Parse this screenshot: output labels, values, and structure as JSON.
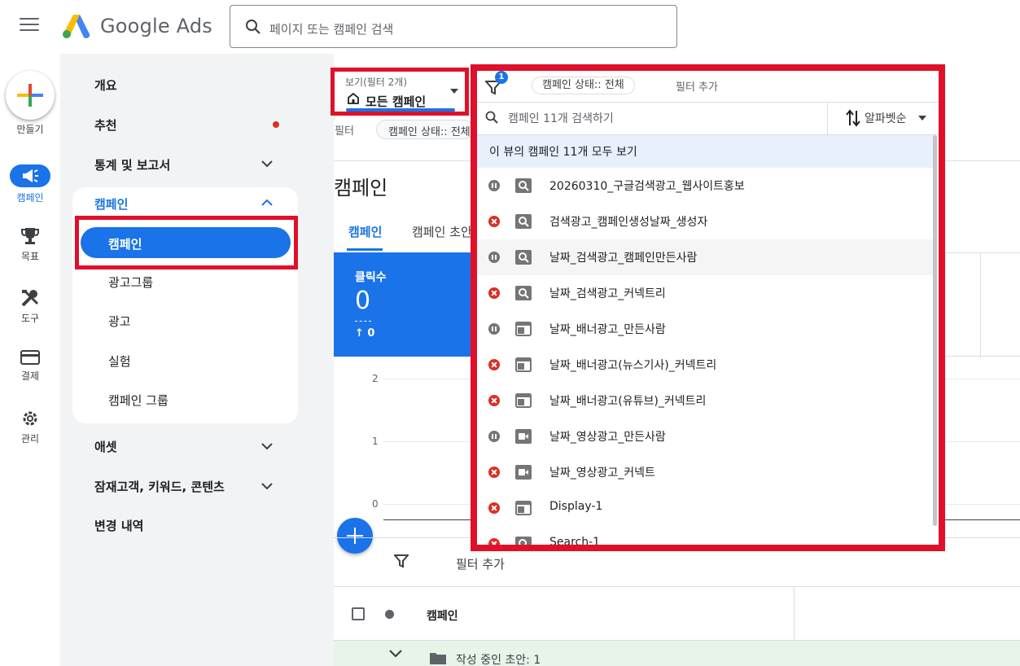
{
  "app": {
    "brand": "Google Ads",
    "search_placeholder": "페이지 또는 캠페인 검색"
  },
  "rail": {
    "create_label": "만들기",
    "items": [
      {
        "label": "캠페인",
        "icon": "megaphone-icon",
        "active": true
      },
      {
        "label": "목표",
        "icon": "trophy-icon"
      },
      {
        "label": "도구",
        "icon": "tools-icon"
      },
      {
        "label": "결제",
        "icon": "credit-card-icon"
      },
      {
        "label": "관리",
        "icon": "gear-icon"
      }
    ]
  },
  "nav": {
    "overview": "개요",
    "recommendations": "추천",
    "reports": "통계 및 보고서",
    "campaigns_section": "캠페인",
    "sub": [
      "캠페인",
      "광고그룹",
      "광고",
      "실험",
      "캠페인 그룹"
    ],
    "assets": "애셋",
    "audiences": "잠재고객, 키워드, 콘텐츠",
    "change_history": "변경 내역"
  },
  "view": {
    "label": "보기(필터 2개)",
    "value": "모든 캠페인"
  },
  "filter_row": {
    "label": "필터",
    "chip": "캠페인 상태:: 전체"
  },
  "main": {
    "title": "캠페인",
    "tabs": [
      "캠페인",
      "캠페인 초안"
    ],
    "metric": {
      "label": "클릭수",
      "value": "0",
      "delta": "↑ 0"
    },
    "chart_yticks": [
      "2",
      "1",
      "0"
    ],
    "filter_add": "필터 추가",
    "table_header": "캠페인",
    "draft_row": "작성 중인 초안: 1"
  },
  "panel": {
    "badge": "1",
    "chip": "캠페인 상태:: 전체",
    "add_filter": "필터 추가",
    "search_placeholder": "캠페인 11개 검색하기",
    "sort": "알파벳순",
    "view_all": "이 뷰의 캠페인 11개 모두 보기",
    "campaigns": [
      {
        "name": "20260310_구글검색광고_웹사이트홍보",
        "status": "paused",
        "type": "search"
      },
      {
        "name": "검색광고_캠페인생성날짜_생성자",
        "status": "removed",
        "type": "search"
      },
      {
        "name": "날짜_검색광고_캠페인만든사람",
        "status": "paused",
        "type": "search"
      },
      {
        "name": "날짜_검색광고_커넥트리",
        "status": "removed",
        "type": "search"
      },
      {
        "name": "날짜_배너광고_만든사람",
        "status": "paused",
        "type": "display"
      },
      {
        "name": "날짜_배너광고(뉴스기사)_커넥트리",
        "status": "removed",
        "type": "display"
      },
      {
        "name": "날짜_배너광고(유튜브)_커넥트리",
        "status": "removed",
        "type": "display"
      },
      {
        "name": "날짜_영상광고_만든사람",
        "status": "paused",
        "type": "video"
      },
      {
        "name": "날짜_영상광고_커넥트",
        "status": "removed",
        "type": "video"
      },
      {
        "name": "Display-1",
        "status": "removed",
        "type": "display"
      },
      {
        "name": "Search-1",
        "status": "removed",
        "type": "search"
      }
    ]
  },
  "colors": {
    "accent": "#1a73e8",
    "highlight_box": "#e0102a",
    "removed": "#d93025",
    "paused": "#757575"
  }
}
